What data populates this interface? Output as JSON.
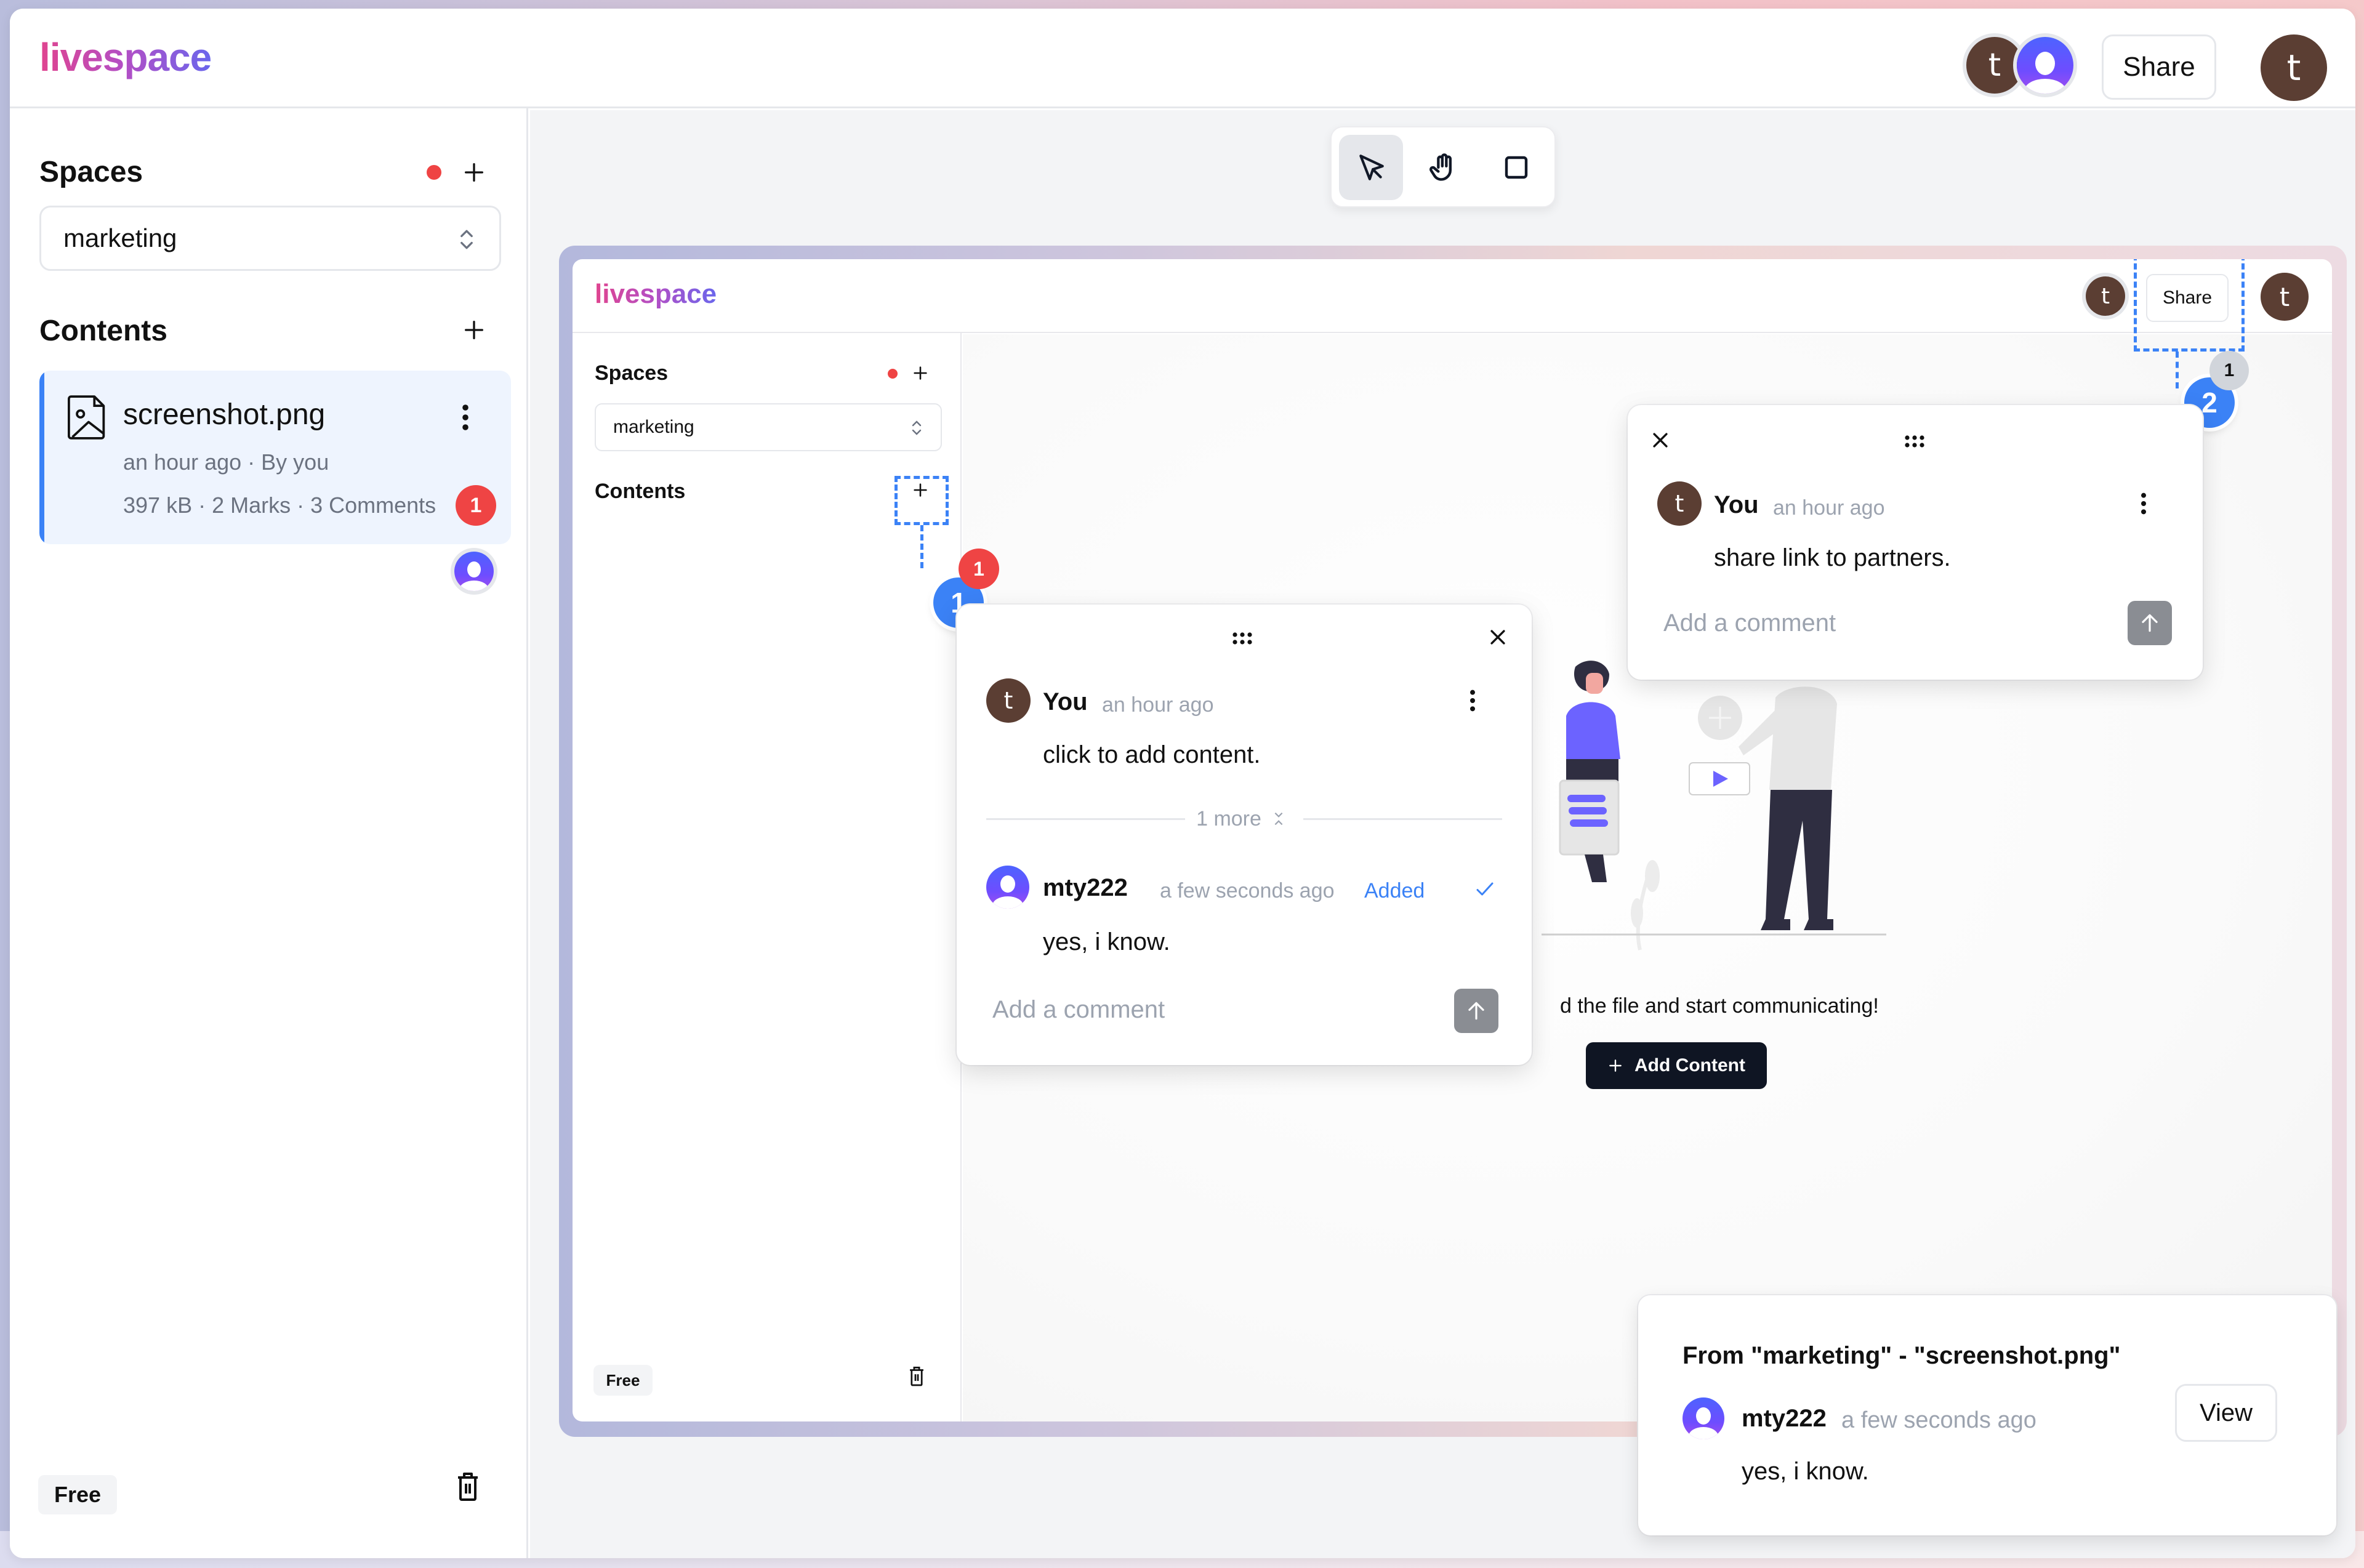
{
  "app": {
    "logo": "livespace",
    "brand_gradient": [
      "#e0448f",
      "#b24fc6",
      "#6a66ec"
    ]
  },
  "header": {
    "collaborators": [
      {
        "initial": "t",
        "type": "letter",
        "color": "#5b3e33"
      },
      {
        "initial": "",
        "type": "user-icon",
        "color": "#4d63ff"
      }
    ],
    "share_label": "Share",
    "current_user_initial": "t"
  },
  "sidebar": {
    "spaces_title": "Spaces",
    "spaces_select_value": "marketing",
    "contents_title": "Contents",
    "files": [
      {
        "name": "screenshot.png",
        "meta": "an hour ago · By you",
        "stats": "397 kB · 2 Marks · 3 Comments",
        "unread_badge": "1"
      }
    ],
    "plan_label": "Free"
  },
  "toolbar": {
    "tools": [
      {
        "name": "select",
        "icon": "cursor-arrow-icon",
        "active": true
      },
      {
        "name": "pan",
        "icon": "hand-icon",
        "active": false
      },
      {
        "name": "rectangle",
        "icon": "square-icon",
        "active": false
      }
    ]
  },
  "embedded_screenshot": {
    "logo": "livespace",
    "header_share_label": "Share",
    "avatar_initial": "t",
    "user_initial": "t",
    "spaces_title": "Spaces",
    "spaces_select_value": "marketing",
    "contents_title": "Contents",
    "plan_label": "Free",
    "empty_state_text": "d the file and start communicating!",
    "add_content_label": "Add Content"
  },
  "marks": [
    {
      "number": "1",
      "count_badge": "1",
      "count_badge_color": "#ef4444",
      "thread": {
        "comments": [
          {
            "author": "You",
            "avatar_initial": "t",
            "time": "an hour ago",
            "text": "click to add content."
          },
          {
            "author": "mty222",
            "avatar_type": "user-icon",
            "time": "a few seconds ago",
            "status": "Added",
            "text": "yes, i know."
          }
        ],
        "collapsed_label": "1 more",
        "input_placeholder": "Add a comment"
      }
    },
    {
      "number": "2",
      "count_badge": "1",
      "count_badge_color": "#d1d5db",
      "thread": {
        "comments": [
          {
            "author": "You",
            "avatar_initial": "t",
            "time": "an hour ago",
            "text": "share link to partners."
          }
        ],
        "input_placeholder": "Add a comment"
      }
    }
  ],
  "notification": {
    "title": "From \"marketing\" - \"screenshot.png\"",
    "author": "mty222",
    "time": "a few seconds ago",
    "text": "yes, i know.",
    "view_label": "View"
  },
  "colors": {
    "accent_blue": "#3b82f6",
    "danger_red": "#ef4444",
    "avatar_brown": "#5b3e33",
    "canvas_bg": "#f3f4f6",
    "added_status": "#3b82f6"
  }
}
